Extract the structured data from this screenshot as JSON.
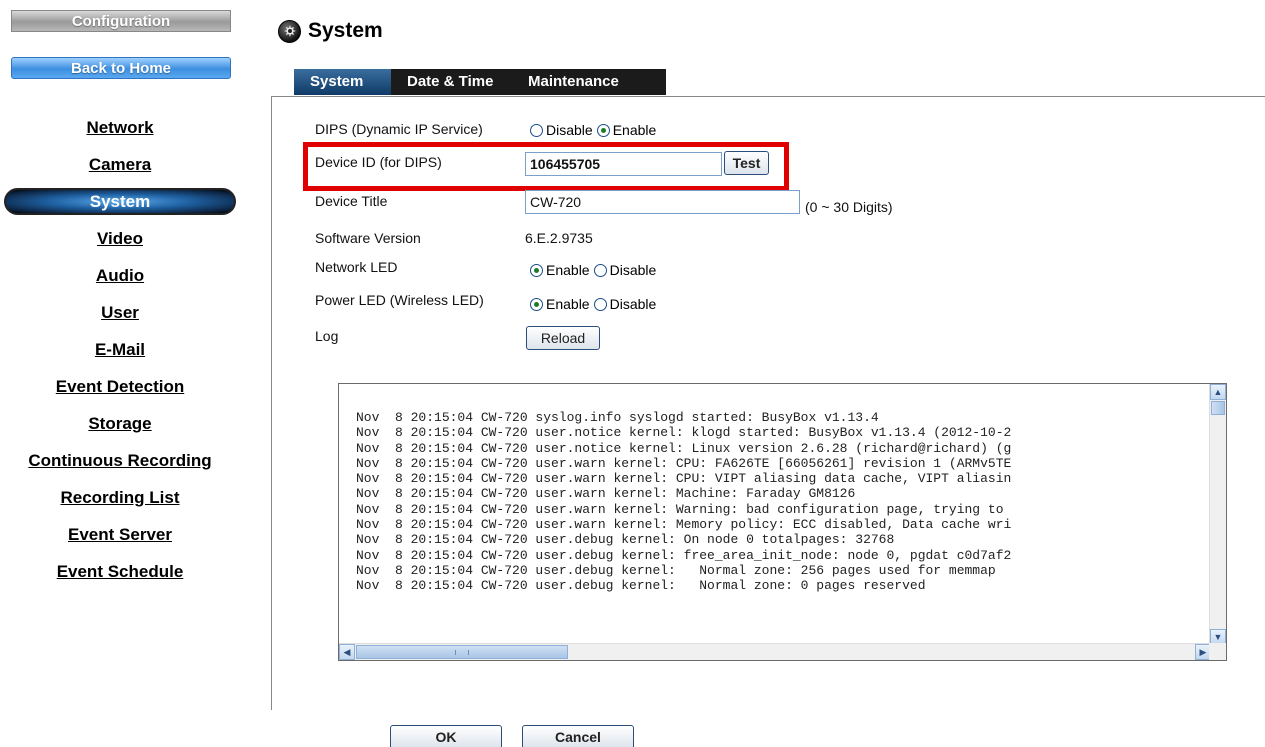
{
  "sidebar": {
    "config_label": "Configuration",
    "home_label": "Back to Home",
    "items": [
      {
        "label": "Network"
      },
      {
        "label": "Camera"
      },
      {
        "label": "System"
      },
      {
        "label": "Video"
      },
      {
        "label": "Audio"
      },
      {
        "label": "User"
      },
      {
        "label": "E-Mail"
      },
      {
        "label": "Event Detection"
      },
      {
        "label": "Storage"
      },
      {
        "label": "Continuous Recording"
      },
      {
        "label": "Recording List"
      },
      {
        "label": "Event Server"
      },
      {
        "label": "Event Schedule"
      }
    ],
    "active_item": "System"
  },
  "header": {
    "title": "System",
    "icon": "system-icon"
  },
  "tabs": [
    {
      "label": "System"
    },
    {
      "label": "Date & Time"
    },
    {
      "label": "Maintenance"
    }
  ],
  "form": {
    "dips": {
      "label": "DIPS (Dynamic IP Service)",
      "option_disable": "Disable",
      "option_enable": "Enable",
      "selected": "Enable"
    },
    "device_id": {
      "label": "Device ID (for DIPS)",
      "value": "106455705",
      "button_label": "Test"
    },
    "device_title": {
      "label": "Device Title",
      "value": "CW-720",
      "hint": "(0 ~ 30 Digits)"
    },
    "software_version": {
      "label": "Software Version",
      "value": "6.E.2.9735"
    },
    "network_led": {
      "label": "Network LED",
      "option_enable": "Enable",
      "option_disable": "Disable",
      "selected": "Enable"
    },
    "power_led": {
      "label": "Power LED (Wireless LED)",
      "option_enable": "Enable",
      "option_disable": "Disable",
      "selected": "Enable"
    },
    "log": {
      "label": "Log",
      "reload_label": "Reload",
      "lines": [
        "Nov  8 20:15:04 CW-720 syslog.info syslogd started: BusyBox v1.13.4",
        "Nov  8 20:15:04 CW-720 user.notice kernel: klogd started: BusyBox v1.13.4 (2012-10-2",
        "Nov  8 20:15:04 CW-720 user.notice kernel: Linux version 2.6.28 (richard@richard) (g",
        "Nov  8 20:15:04 CW-720 user.warn kernel: CPU: FA626TE [66056261] revision 1 (ARMv5TE",
        "Nov  8 20:15:04 CW-720 user.warn kernel: CPU: VIPT aliasing data cache, VIPT aliasin",
        "Nov  8 20:15:04 CW-720 user.warn kernel: Machine: Faraday GM8126",
        "Nov  8 20:15:04 CW-720 user.warn kernel: Warning: bad configuration page, trying to",
        "Nov  8 20:15:04 CW-720 user.warn kernel: Memory policy: ECC disabled, Data cache wri",
        "Nov  8 20:15:04 CW-720 user.debug kernel: On node 0 totalpages: 32768",
        "Nov  8 20:15:04 CW-720 user.debug kernel: free_area_init_node: node 0, pgdat c0d7af2",
        "Nov  8 20:15:04 CW-720 user.debug kernel:   Normal zone: 256 pages used for memmap",
        "Nov  8 20:15:04 CW-720 user.debug kernel:   Normal zone: 0 pages reserved"
      ]
    }
  },
  "footer": {
    "ok_label": "OK",
    "cancel_label": "Cancel"
  },
  "colors": {
    "highlight_border": "#e00000",
    "tab_bar": "#1b1b1b",
    "active_tab": "#0f3a66",
    "home_button": "#3d8fe0"
  }
}
